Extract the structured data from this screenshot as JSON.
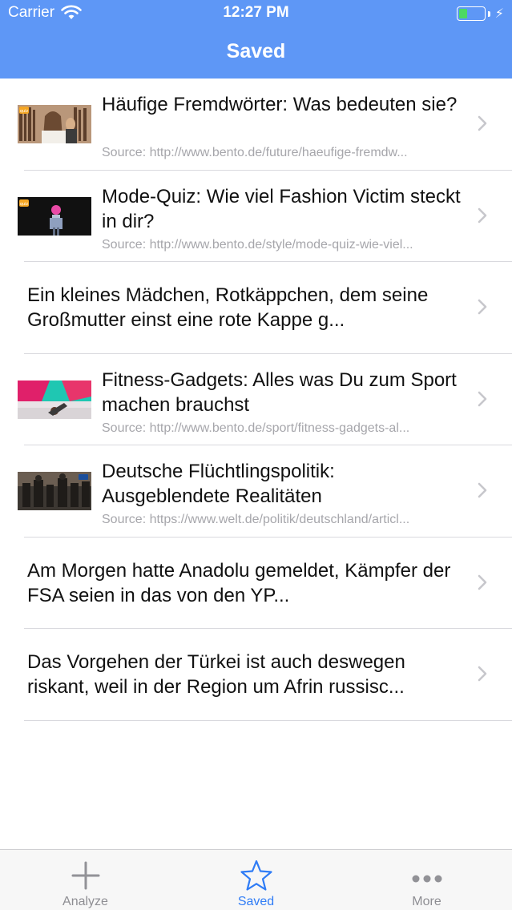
{
  "status_bar": {
    "carrier": "Carrier",
    "time": "12:27 PM",
    "battery_level": 0.35
  },
  "nav": {
    "title": "Saved"
  },
  "items": [
    {
      "title": "Häufige Fremdwörter: Was bedeuten sie?",
      "source": "Source: http://www.bento.de/future/haeufige-fremdw...",
      "has_image": true,
      "image": "library-students-photo"
    },
    {
      "title": "Mode-Quiz: Wie viel Fashion Victim steckt in dir?",
      "source": "Source: http://www.bento.de/style/mode-quiz-wie-viel...",
      "has_image": true,
      "image": "fashion-model-photo"
    },
    {
      "title": "Ein kleines Mädchen, Rotkäppchen, dem seine Großmutter einst eine rote Kappe g...",
      "source": "",
      "has_image": false
    },
    {
      "title": "Fitness-Gadgets: Alles was Du zum Sport machen brauchst",
      "source": "Source: http://www.bento.de/sport/fitness-gadgets-al...",
      "has_image": true,
      "image": "yoga-fitness-photo"
    },
    {
      "title": "Deutsche Flüchtlingspolitik: Ausgeblendete Realitäten",
      "source": "Source: https://www.welt.de/politik/deutschland/articl...",
      "has_image": true,
      "image": "crowd-news-photo"
    },
    {
      "title": "Am Morgen hatte Anadolu gemeldet, Kämpfer der FSA seien in das von den YP...",
      "source": "",
      "has_image": false
    },
    {
      "title": "Das Vorgehen der Türkei ist auch deswegen riskant, weil in der Region um Afrin russisc...",
      "source": "",
      "has_image": false
    }
  ],
  "tabbar": {
    "tabs": [
      {
        "label": "Analyze",
        "icon": "plus-icon",
        "active": false
      },
      {
        "label": "Saved",
        "icon": "star-icon",
        "active": true
      },
      {
        "label": "More",
        "icon": "more-icon",
        "active": false
      }
    ]
  },
  "colors": {
    "nav_bar": "#5e97f6",
    "tab_active": "#2f7cf6",
    "tab_inactive": "#8e8e93",
    "separator": "#d9d9de"
  }
}
